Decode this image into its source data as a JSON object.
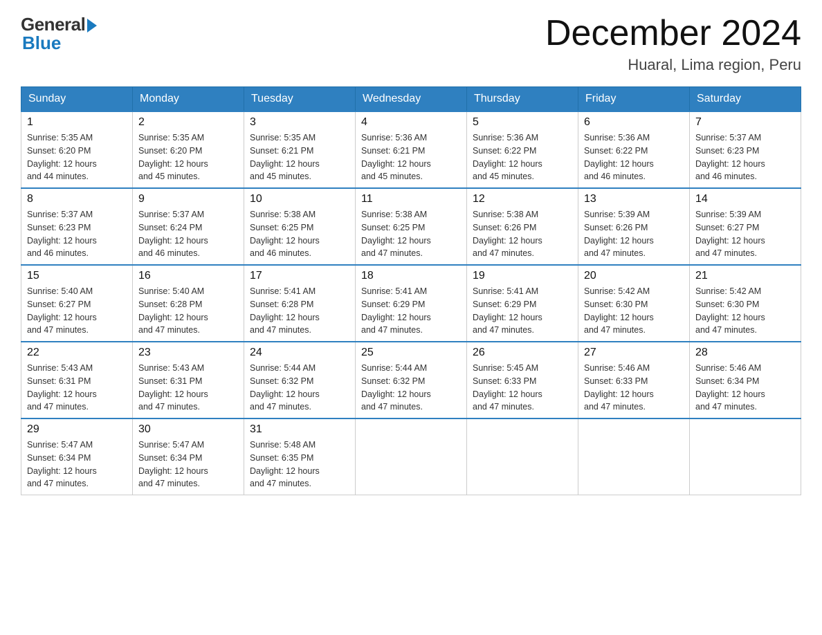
{
  "logo": {
    "general": "General",
    "blue": "Blue"
  },
  "header": {
    "month": "December 2024",
    "location": "Huaral, Lima region, Peru"
  },
  "days_of_week": [
    "Sunday",
    "Monday",
    "Tuesday",
    "Wednesday",
    "Thursday",
    "Friday",
    "Saturday"
  ],
  "weeks": [
    [
      {
        "day": "1",
        "sunrise": "5:35 AM",
        "sunset": "6:20 PM",
        "daylight": "12 hours and 44 minutes."
      },
      {
        "day": "2",
        "sunrise": "5:35 AM",
        "sunset": "6:20 PM",
        "daylight": "12 hours and 45 minutes."
      },
      {
        "day": "3",
        "sunrise": "5:35 AM",
        "sunset": "6:21 PM",
        "daylight": "12 hours and 45 minutes."
      },
      {
        "day": "4",
        "sunrise": "5:36 AM",
        "sunset": "6:21 PM",
        "daylight": "12 hours and 45 minutes."
      },
      {
        "day": "5",
        "sunrise": "5:36 AM",
        "sunset": "6:22 PM",
        "daylight": "12 hours and 45 minutes."
      },
      {
        "day": "6",
        "sunrise": "5:36 AM",
        "sunset": "6:22 PM",
        "daylight": "12 hours and 46 minutes."
      },
      {
        "day": "7",
        "sunrise": "5:37 AM",
        "sunset": "6:23 PM",
        "daylight": "12 hours and 46 minutes."
      }
    ],
    [
      {
        "day": "8",
        "sunrise": "5:37 AM",
        "sunset": "6:23 PM",
        "daylight": "12 hours and 46 minutes."
      },
      {
        "day": "9",
        "sunrise": "5:37 AM",
        "sunset": "6:24 PM",
        "daylight": "12 hours and 46 minutes."
      },
      {
        "day": "10",
        "sunrise": "5:38 AM",
        "sunset": "6:25 PM",
        "daylight": "12 hours and 46 minutes."
      },
      {
        "day": "11",
        "sunrise": "5:38 AM",
        "sunset": "6:25 PM",
        "daylight": "12 hours and 47 minutes."
      },
      {
        "day": "12",
        "sunrise": "5:38 AM",
        "sunset": "6:26 PM",
        "daylight": "12 hours and 47 minutes."
      },
      {
        "day": "13",
        "sunrise": "5:39 AM",
        "sunset": "6:26 PM",
        "daylight": "12 hours and 47 minutes."
      },
      {
        "day": "14",
        "sunrise": "5:39 AM",
        "sunset": "6:27 PM",
        "daylight": "12 hours and 47 minutes."
      }
    ],
    [
      {
        "day": "15",
        "sunrise": "5:40 AM",
        "sunset": "6:27 PM",
        "daylight": "12 hours and 47 minutes."
      },
      {
        "day": "16",
        "sunrise": "5:40 AM",
        "sunset": "6:28 PM",
        "daylight": "12 hours and 47 minutes."
      },
      {
        "day": "17",
        "sunrise": "5:41 AM",
        "sunset": "6:28 PM",
        "daylight": "12 hours and 47 minutes."
      },
      {
        "day": "18",
        "sunrise": "5:41 AM",
        "sunset": "6:29 PM",
        "daylight": "12 hours and 47 minutes."
      },
      {
        "day": "19",
        "sunrise": "5:41 AM",
        "sunset": "6:29 PM",
        "daylight": "12 hours and 47 minutes."
      },
      {
        "day": "20",
        "sunrise": "5:42 AM",
        "sunset": "6:30 PM",
        "daylight": "12 hours and 47 minutes."
      },
      {
        "day": "21",
        "sunrise": "5:42 AM",
        "sunset": "6:30 PM",
        "daylight": "12 hours and 47 minutes."
      }
    ],
    [
      {
        "day": "22",
        "sunrise": "5:43 AM",
        "sunset": "6:31 PM",
        "daylight": "12 hours and 47 minutes."
      },
      {
        "day": "23",
        "sunrise": "5:43 AM",
        "sunset": "6:31 PM",
        "daylight": "12 hours and 47 minutes."
      },
      {
        "day": "24",
        "sunrise": "5:44 AM",
        "sunset": "6:32 PM",
        "daylight": "12 hours and 47 minutes."
      },
      {
        "day": "25",
        "sunrise": "5:44 AM",
        "sunset": "6:32 PM",
        "daylight": "12 hours and 47 minutes."
      },
      {
        "day": "26",
        "sunrise": "5:45 AM",
        "sunset": "6:33 PM",
        "daylight": "12 hours and 47 minutes."
      },
      {
        "day": "27",
        "sunrise": "5:46 AM",
        "sunset": "6:33 PM",
        "daylight": "12 hours and 47 minutes."
      },
      {
        "day": "28",
        "sunrise": "5:46 AM",
        "sunset": "6:34 PM",
        "daylight": "12 hours and 47 minutes."
      }
    ],
    [
      {
        "day": "29",
        "sunrise": "5:47 AM",
        "sunset": "6:34 PM",
        "daylight": "12 hours and 47 minutes."
      },
      {
        "day": "30",
        "sunrise": "5:47 AM",
        "sunset": "6:34 PM",
        "daylight": "12 hours and 47 minutes."
      },
      {
        "day": "31",
        "sunrise": "5:48 AM",
        "sunset": "6:35 PM",
        "daylight": "12 hours and 47 minutes."
      },
      null,
      null,
      null,
      null
    ]
  ],
  "labels": {
    "sunrise": "Sunrise:",
    "sunset": "Sunset:",
    "daylight": "Daylight:"
  }
}
